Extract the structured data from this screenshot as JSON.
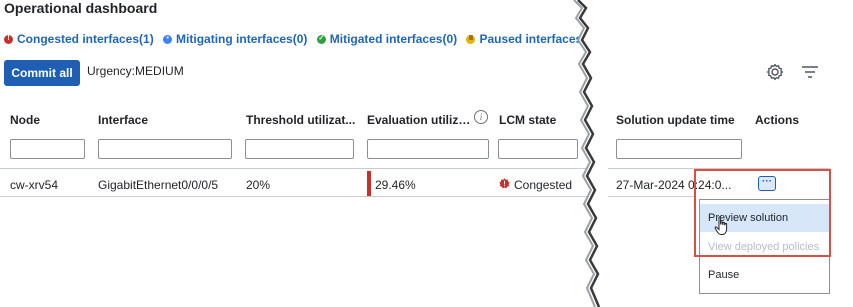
{
  "page": {
    "title": "Operational dashboard"
  },
  "status_summary": [
    {
      "label": "Congested interfaces(1)",
      "icon": "error-icon",
      "color": "#c8312b"
    },
    {
      "label": "Mitigating interfaces(0)",
      "icon": "in-progress-icon",
      "color": "#3b82f6"
    },
    {
      "label": "Mitigated  interfaces(0)",
      "icon": "check-icon",
      "color": "#2f9e44"
    },
    {
      "label": "Paused interfaces(",
      "icon": "pause-icon",
      "color": "#e8b10a"
    }
  ],
  "toolbar": {
    "commit_label": "Commit all",
    "urgency_label": "Urgency:",
    "urgency_value": "MEDIUM"
  },
  "table": {
    "columns": [
      "Node",
      "Interface",
      "Threshold utilizat...",
      "Evaluation utiliza...",
      "LCM state",
      "Solution update time",
      "Actions"
    ],
    "rows": [
      {
        "node": "cw-xrv54",
        "interface": "GigabitEthernet0/0/0/5",
        "threshold": "20%",
        "evaluation": "29.46%",
        "lcm_state": "Congested",
        "solution_time_a": "27-Mar-2024 0",
        "solution_time_b": ":24:0..."
      }
    ]
  },
  "actions_menu": {
    "button_label": "···",
    "items": [
      "Preview solution",
      "View deployed policies",
      "Pause"
    ]
  },
  "colors": {
    "accent": "#1e5fb4",
    "link": "#1f66b8",
    "danger": "#c8312b",
    "highlight": "#d84f45"
  }
}
